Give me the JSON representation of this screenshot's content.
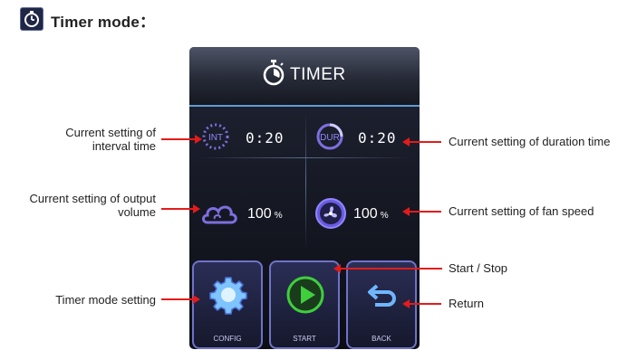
{
  "header": {
    "title": "Timer mode：",
    "icon": "stopwatch-icon"
  },
  "device": {
    "title": "TIMER",
    "title_icon": "stopwatch-icon",
    "interval": {
      "badge": "INT",
      "value": "0:20"
    },
    "duration": {
      "badge": "DUR",
      "value": "0:20"
    },
    "volume": {
      "value": "100",
      "unit": "%"
    },
    "fan": {
      "value": "100",
      "unit": "%"
    },
    "buttons": {
      "config": "CONFIG",
      "start": "START",
      "back": "BACK"
    },
    "colors": {
      "accent_blue": "#5f9bd6",
      "icon_purple": "#7d6fe0",
      "start_green": "#3fcf3c"
    }
  },
  "annotations": {
    "interval": [
      "Current setting of",
      "interval time"
    ],
    "duration": "Current setting of duration time",
    "volume": [
      "Current setting of output",
      "volume"
    ],
    "fan": "Current setting of fan speed",
    "start_stop": "Start / Stop",
    "config": "Timer mode setting",
    "back": "Return"
  }
}
